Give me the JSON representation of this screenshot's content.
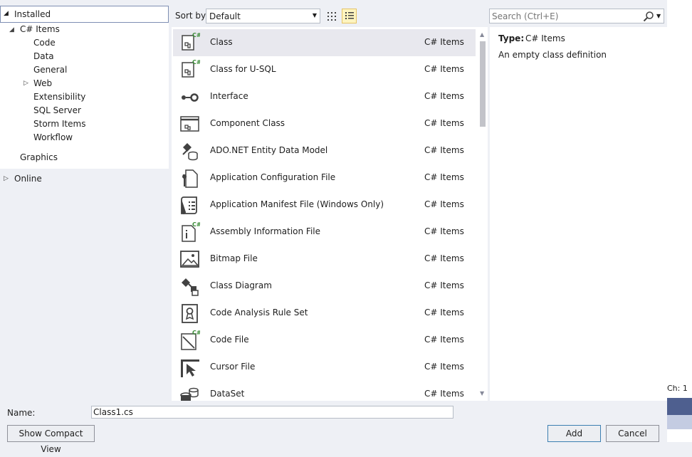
{
  "tree": {
    "installed_label": "Installed",
    "root_label": "C# Items",
    "children": [
      {
        "label": "Code"
      },
      {
        "label": "Data"
      },
      {
        "label": "General"
      },
      {
        "label": "Web"
      },
      {
        "label": "Extensibility"
      },
      {
        "label": "SQL Server"
      },
      {
        "label": "Storm Items"
      },
      {
        "label": "Workflow"
      }
    ],
    "graphics_label": "Graphics",
    "online_label": "Online"
  },
  "toolbar": {
    "sort_label": "Sort by:",
    "sort_value": "Default",
    "search_placeholder": "Search (Ctrl+E)"
  },
  "templates": [
    {
      "name": "Class",
      "type": "C# Items",
      "icon": "class-icon"
    },
    {
      "name": "Class for U-SQL",
      "type": "C# Items",
      "icon": "usql-class-icon"
    },
    {
      "name": "Interface",
      "type": "C# Items",
      "icon": "interface-icon"
    },
    {
      "name": "Component Class",
      "type": "C# Items",
      "icon": "component-class-icon"
    },
    {
      "name": "ADO.NET Entity Data Model",
      "type": "C# Items",
      "icon": "entity-data-model-icon"
    },
    {
      "name": "Application Configuration File",
      "type": "C# Items",
      "icon": "config-file-icon"
    },
    {
      "name": "Application Manifest File (Windows Only)",
      "type": "C# Items",
      "icon": "manifest-file-icon"
    },
    {
      "name": "Assembly Information File",
      "type": "C# Items",
      "icon": "assembly-info-icon"
    },
    {
      "name": "Bitmap File",
      "type": "C# Items",
      "icon": "bitmap-icon"
    },
    {
      "name": "Class Diagram",
      "type": "C# Items",
      "icon": "class-diagram-icon"
    },
    {
      "name": "Code Analysis Rule Set",
      "type": "C# Items",
      "icon": "rule-set-icon"
    },
    {
      "name": "Code File",
      "type": "C# Items",
      "icon": "code-file-icon"
    },
    {
      "name": "Cursor File",
      "type": "C# Items",
      "icon": "cursor-file-icon"
    },
    {
      "name": "DataSet",
      "type": "C# Items",
      "icon": "dataset-icon"
    }
  ],
  "details": {
    "type_label": "Type:",
    "type_value": "C# Items",
    "description": "An empty class definition"
  },
  "editor": {
    "ch_label": "Ch: 1"
  },
  "footer": {
    "name_label": "Name:",
    "name_value": "Class1.cs",
    "compact_label": "Show Compact View",
    "add_label": "Add",
    "cancel_label": "Cancel"
  }
}
